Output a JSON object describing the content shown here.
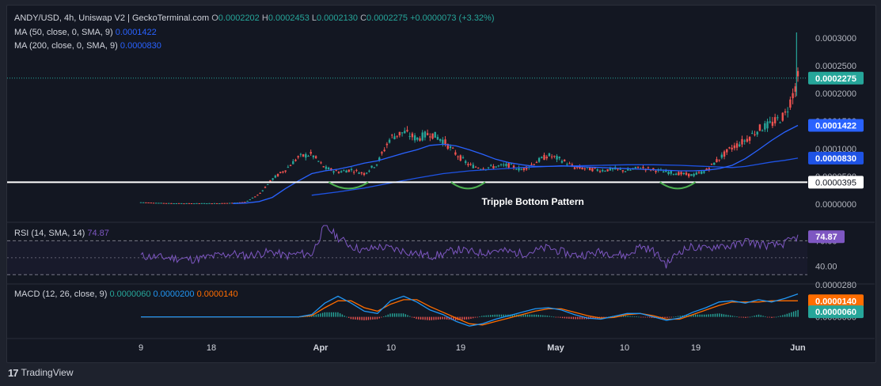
{
  "header": {
    "pair": "ANDY/USD, 4h, Uniswap V2 | GeckoTerminal.com",
    "o_label": "O",
    "o_value": "0.0002202",
    "h_label": "H",
    "h_value": "0.0002453",
    "l_label": "L",
    "l_value": "0.0002130",
    "c_label": "C",
    "c_value": "0.0002275",
    "change": "+0.0000073 (+3.32%)",
    "ma50_label": "MA (50, close, 0, SMA, 9)",
    "ma50_value": "0.0001422",
    "ma200_label": "MA (200, close, 0, SMA, 9)",
    "ma200_value": "0.0000830"
  },
  "colors": {
    "bg": "#131722",
    "up": "#26a69a",
    "down": "#ef5350",
    "ma50": "#2962ff",
    "ma200": "#1e53e5",
    "rsi": "#7e57c2",
    "macd": "#2196f3",
    "signal": "#ff6d00",
    "pattern": "#4caf50",
    "text": "#b2b5be"
  },
  "chart_data": [
    {
      "type": "candlestick",
      "panel": "price",
      "ylim": [
        0,
        0.00032
      ],
      "y_ticks": [
        "0.0003000",
        "0.0002500",
        "0.0002000",
        "0.0001500",
        "0.0001000",
        "0.0000500",
        "0.0000000"
      ],
      "y_tick_values": [
        0.0003,
        0.00025,
        0.0002,
        0.00015,
        0.0001,
        5e-05,
        0
      ],
      "x_ticks": [
        "9",
        "18",
        "Apr",
        "10",
        "19",
        "May",
        "10",
        "19",
        "Jun"
      ],
      "price_path": [
        [
          0,
          3.3e-06
        ],
        [
          1,
          2.4e-06
        ],
        [
          2,
          1.7e-06
        ],
        [
          3,
          1.4e-06
        ],
        [
          4,
          1.4e-06
        ],
        [
          5,
          1.5e-06
        ],
        [
          6,
          1.5e-06
        ],
        [
          7,
          2.2e-06
        ],
        [
          8,
          4e-06
        ],
        [
          9,
          1.8e-05
        ],
        [
          10,
          4.5e-05
        ],
        [
          11,
          6.2e-05
        ],
        [
          12,
          8.5e-05
        ],
        [
          13,
          9e-05
        ],
        [
          14,
          6.5e-05
        ],
        [
          15,
          5.8e-05
        ],
        [
          16,
          6.2e-05
        ],
        [
          17,
          5.5e-05
        ],
        [
          18,
          7.4e-05
        ],
        [
          19,
          0.00012
        ],
        [
          20,
          0.00013
        ],
        [
          21,
          0.000118
        ],
        [
          22,
          0.000128
        ],
        [
          23,
          0.000115
        ],
        [
          24,
          9e-05
        ],
        [
          25,
          7e-05
        ],
        [
          26,
          6.5e-05
        ],
        [
          27,
          6.8e-05
        ],
        [
          28,
          7e-05
        ],
        [
          29,
          6.2e-05
        ],
        [
          30,
          7.5e-05
        ],
        [
          31,
          8.8e-05
        ],
        [
          32,
          8e-05
        ],
        [
          33,
          6.6e-05
        ],
        [
          34,
          6.4e-05
        ],
        [
          35,
          6.1e-05
        ],
        [
          36,
          6.3e-05
        ],
        [
          37,
          6e-05
        ],
        [
          38,
          6.6e-05
        ],
        [
          39,
          6.2e-05
        ],
        [
          40,
          5.8e-05
        ],
        [
          41,
          5.5e-05
        ],
        [
          42,
          5.2e-05
        ],
        [
          43,
          6e-05
        ],
        [
          44,
          8.2e-05
        ],
        [
          45,
          0.000102
        ],
        [
          46,
          0.000115
        ],
        [
          47,
          0.000135
        ],
        [
          48,
          0.000145
        ],
        [
          49,
          0.00016
        ],
        [
          49.5,
          0.00019
        ],
        [
          50,
          0.0002275
        ]
      ],
      "last_price": 0.0002275,
      "last_price_label": "0.0002275",
      "ma50_path": [
        [
          7,
          1e-06
        ],
        [
          8,
          1.8e-06
        ],
        [
          9,
          4.5e-06
        ],
        [
          10,
          1.2e-05
        ],
        [
          11,
          2.8e-05
        ],
        [
          12,
          4.2e-05
        ],
        [
          13,
          5.5e-05
        ],
        [
          14,
          6e-05
        ],
        [
          15,
          6.3e-05
        ],
        [
          16,
          6.8e-05
        ],
        [
          17,
          7.4e-05
        ],
        [
          18,
          7.8e-05
        ],
        [
          19,
          8.5e-05
        ],
        [
          20,
          9.2e-05
        ],
        [
          21,
          9.8e-05
        ],
        [
          22,
          0.000106
        ],
        [
          23,
          0.000108
        ],
        [
          24,
          0.000105
        ],
        [
          25,
          9.8e-05
        ],
        [
          26,
          9e-05
        ],
        [
          27,
          8.1e-05
        ],
        [
          28,
          7.5e-05
        ],
        [
          29,
          7.1e-05
        ],
        [
          30,
          6.8e-05
        ],
        [
          31,
          6.8e-05
        ],
        [
          32,
          6.9e-05
        ],
        [
          33,
          6.8e-05
        ],
        [
          34,
          6.7e-05
        ],
        [
          35,
          6.6e-05
        ],
        [
          36,
          6.5e-05
        ],
        [
          37,
          6.4e-05
        ],
        [
          38,
          6.3e-05
        ],
        [
          39,
          6.2e-05
        ],
        [
          40,
          6.1e-05
        ],
        [
          41,
          6e-05
        ],
        [
          42,
          6e-05
        ],
        [
          43,
          6.1e-05
        ],
        [
          44,
          6.4e-05
        ],
        [
          45,
          7e-05
        ],
        [
          46,
          8.2e-05
        ],
        [
          47,
          9.8e-05
        ],
        [
          48,
          0.000115
        ],
        [
          49,
          0.00013
        ],
        [
          50,
          0.0001422
        ]
      ],
      "ma200_path": [
        [
          13,
          1.6e-05
        ],
        [
          15,
          2.2e-05
        ],
        [
          17,
          2.9e-05
        ],
        [
          19,
          3.8e-05
        ],
        [
          21,
          4.7e-05
        ],
        [
          23,
          5.5e-05
        ],
        [
          25,
          6e-05
        ],
        [
          27,
          6.3e-05
        ],
        [
          29,
          6.6e-05
        ],
        [
          31,
          6.8e-05
        ],
        [
          33,
          6.9e-05
        ],
        [
          35,
          7e-05
        ],
        [
          37,
          7.1e-05
        ],
        [
          39,
          7.1e-05
        ],
        [
          41,
          7e-05
        ],
        [
          43,
          6.8e-05
        ],
        [
          45,
          6.6e-05
        ],
        [
          46,
          6.8e-05
        ],
        [
          47,
          7.2e-05
        ],
        [
          48,
          7.6e-05
        ],
        [
          49,
          7.9e-05
        ],
        [
          50,
          8.3e-05
        ]
      ],
      "ma50_label": "0.0001422",
      "ma200_label": "0.0000830",
      "support": {
        "value": 3.95e-05,
        "label": "0.0000395"
      },
      "annotation": {
        "text": "Tripple Bottom Pattern",
        "x": 27.5,
        "y": 1.5e-06
      },
      "bottoms": [
        [
          14.3,
          17.3
        ],
        [
          23.6,
          26.2
        ],
        [
          39.5,
          42.2
        ]
      ]
    },
    {
      "type": "line",
      "panel": "rsi",
      "title": "RSI (14, SMA, 14)",
      "value_label": "74.87",
      "ylim": [
        20,
        90
      ],
      "y_ticks": [
        "70.00",
        "40.00"
      ],
      "bands": [
        70,
        30
      ],
      "path": [
        [
          0,
          52
        ],
        [
          2,
          50
        ],
        [
          4,
          48
        ],
        [
          6,
          53
        ],
        [
          7,
          55
        ],
        [
          8,
          52
        ],
        [
          9,
          55
        ],
        [
          10,
          57
        ],
        [
          11,
          52
        ],
        [
          12,
          55
        ],
        [
          13,
          54
        ],
        [
          14,
          88
        ],
        [
          15,
          74
        ],
        [
          16,
          64
        ],
        [
          17,
          58
        ],
        [
          18,
          63
        ],
        [
          19,
          61
        ],
        [
          20,
          58
        ],
        [
          21,
          55
        ],
        [
          22,
          52
        ],
        [
          23,
          54
        ],
        [
          24,
          60
        ],
        [
          25,
          57
        ],
        [
          26,
          56
        ],
        [
          27,
          59
        ],
        [
          28,
          57
        ],
        [
          29,
          55
        ],
        [
          30,
          58
        ],
        [
          31,
          62
        ],
        [
          32,
          57
        ],
        [
          33,
          53
        ],
        [
          34,
          54
        ],
        [
          35,
          57
        ],
        [
          36,
          55
        ],
        [
          37,
          52
        ],
        [
          38,
          64
        ],
        [
          39,
          58
        ],
        [
          40,
          42
        ],
        [
          41,
          58
        ],
        [
          42,
          63
        ],
        [
          43,
          60
        ],
        [
          44,
          65
        ],
        [
          45,
          63
        ],
        [
          46,
          70
        ],
        [
          47,
          66
        ],
        [
          48,
          64
        ],
        [
          49,
          67
        ],
        [
          50,
          74.87
        ]
      ]
    },
    {
      "type": "macd",
      "panel": "macd",
      "title": "MACD (12, 26, close, 9)",
      "values": {
        "histogram": "0.0000060",
        "macd": "0.0000200",
        "signal": "0.0000140"
      },
      "labels": {
        "signal": "0.0000140",
        "histogram": "0.0000060"
      },
      "y_ticks": [
        "0.0000280",
        "0.0000000"
      ],
      "ylim": [
        -1.2e-05,
        2.8e-05
      ],
      "macd_path": [
        [
          0,
          0
        ],
        [
          12,
          0
        ],
        [
          13,
          2e-06
        ],
        [
          14,
          1.2e-05
        ],
        [
          15,
          1.8e-05
        ],
        [
          16,
          1.2e-05
        ],
        [
          17,
          5e-06
        ],
        [
          18,
          3e-06
        ],
        [
          19,
          1.4e-05
        ],
        [
          20,
          1.8e-05
        ],
        [
          21,
          1.3e-05
        ],
        [
          22,
          6e-06
        ],
        [
          23,
          2e-06
        ],
        [
          24,
          -4e-06
        ],
        [
          25,
          -8e-06
        ],
        [
          26,
          -6e-06
        ],
        [
          27,
          -2e-06
        ],
        [
          28,
          1e-06
        ],
        [
          29,
          4e-06
        ],
        [
          30,
          7e-06
        ],
        [
          31,
          8e-06
        ],
        [
          32,
          6e-06
        ],
        [
          33,
          2e-06
        ],
        [
          34,
          -1e-06
        ],
        [
          35,
          -2e-06
        ],
        [
          36,
          5e-07
        ],
        [
          37,
          3e-06
        ],
        [
          38,
          3e-06
        ],
        [
          39,
          0
        ],
        [
          40,
          -3e-06
        ],
        [
          41,
          -1e-06
        ],
        [
          42,
          4e-06
        ],
        [
          43,
          8e-06
        ],
        [
          44,
          1.3e-05
        ],
        [
          45,
          1.4e-05
        ],
        [
          46,
          1.2e-05
        ],
        [
          47,
          1.5e-05
        ],
        [
          48,
          1.3e-05
        ],
        [
          49,
          1.6e-05
        ],
        [
          50,
          2e-05
        ]
      ],
      "signal_path": [
        [
          0,
          0
        ],
        [
          12,
          0
        ],
        [
          13,
          1e-06
        ],
        [
          14,
          8e-06
        ],
        [
          15,
          1.4e-05
        ],
        [
          16,
          1.4e-05
        ],
        [
          17,
          8e-06
        ],
        [
          18,
          5e-06
        ],
        [
          19,
          1.1e-05
        ],
        [
          20,
          1.5e-05
        ],
        [
          21,
          1.5e-05
        ],
        [
          22,
          9e-06
        ],
        [
          23,
          4e-06
        ],
        [
          24,
          -1e-06
        ],
        [
          25,
          -6e-06
        ],
        [
          26,
          -7e-06
        ],
        [
          27,
          -4e-06
        ],
        [
          28,
          -1e-06
        ],
        [
          29,
          2e-06
        ],
        [
          30,
          5e-06
        ],
        [
          31,
          7e-06
        ],
        [
          32,
          7e-06
        ],
        [
          33,
          4e-06
        ],
        [
          34,
          1e-06
        ],
        [
          35,
          -1e-06
        ],
        [
          36,
          -5e-07
        ],
        [
          37,
          2e-06
        ],
        [
          38,
          3e-06
        ],
        [
          39,
          1e-06
        ],
        [
          40,
          -2e-06
        ],
        [
          41,
          -2e-06
        ],
        [
          42,
          2e-06
        ],
        [
          43,
          6e-06
        ],
        [
          44,
          1e-05
        ],
        [
          45,
          1.3e-05
        ],
        [
          46,
          1.3e-05
        ],
        [
          47,
          1.3e-05
        ],
        [
          48,
          1.4e-05
        ],
        [
          49,
          1.4e-05
        ],
        [
          50,
          1.4e-05
        ]
      ]
    }
  ],
  "footer": {
    "brand": "TradingView",
    "logo_text": "17"
  }
}
